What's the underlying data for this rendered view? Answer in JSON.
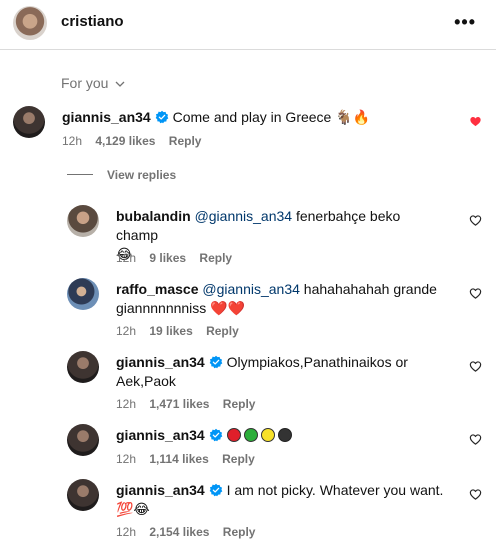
{
  "header": {
    "username": "cristiano",
    "more_label": "•••"
  },
  "sort_label": "For you",
  "view_replies_label": "View replies",
  "colors": {
    "mention": "#00376b",
    "verified": "#0095f6",
    "liked_heart": "#ff3040"
  },
  "comments": [
    {
      "username": "giannis_an34",
      "verified": true,
      "text": "Come and play in Greece 🐐🔥",
      "time": "12h",
      "likes": "4,129 likes",
      "reply": "Reply",
      "liked": true
    },
    {
      "username": "bubalandin",
      "verified": false,
      "mention": "@giannis_an34",
      "text": "fenerbahçe beko champ",
      "text2": "😂",
      "time": "12h",
      "likes": "9 likes",
      "reply": "Reply",
      "liked": false
    },
    {
      "username": "raffo_masce",
      "verified": false,
      "mention": "@giannis_an34",
      "text": "hahahahahah grande",
      "text2": "giannnnnnniss ❤️❤️",
      "time": "12h",
      "likes": "19 likes",
      "reply": "Reply",
      "liked": false
    },
    {
      "username": "giannis_an34",
      "verified": true,
      "text": "Olympiakos,Panathinaikos or",
      "text2": "Aek,Paok",
      "time": "12h",
      "likes": "1,471 likes",
      "reply": "Reply",
      "liked": false
    },
    {
      "username": "giannis_an34",
      "verified": true,
      "text": "🔴🟢🟡⚫",
      "time": "12h",
      "likes": "1,114 likes",
      "reply": "Reply",
      "liked": false
    },
    {
      "username": "giannis_an34",
      "verified": true,
      "text": "I am not picky. Whatever you want.",
      "text2": "💯😂",
      "time": "12h",
      "likes": "2,154 likes",
      "reply": "Reply",
      "liked": false
    }
  ]
}
